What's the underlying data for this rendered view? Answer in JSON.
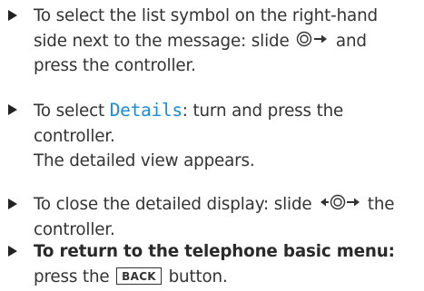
{
  "instructions": [
    {
      "text_before": "To select the list symbol on the right-hand",
      "text_line2_before": "side next to the message: slide",
      "controller_icon": "controller-slide-right-icon",
      "text_line2_after": "and",
      "text_line3": "press the controller."
    },
    {
      "text_before": "To select",
      "highlight": "Details",
      "text_after": ": turn and press the",
      "text_line2": "controller.",
      "result_line": "The detailed view appears."
    },
    {
      "text_before": "To close the detailed display: slide",
      "controller_icon": "controller-slide-left-right-icon",
      "text_after": "the",
      "text_line2": "controller."
    },
    {
      "bold_text": "To return to the telephone basic menu:",
      "text_before_key": "press the",
      "key_label": "BACK",
      "text_after_key": "button."
    }
  ],
  "colors": {
    "text": "#333333",
    "highlight": "#1a8cd8"
  }
}
